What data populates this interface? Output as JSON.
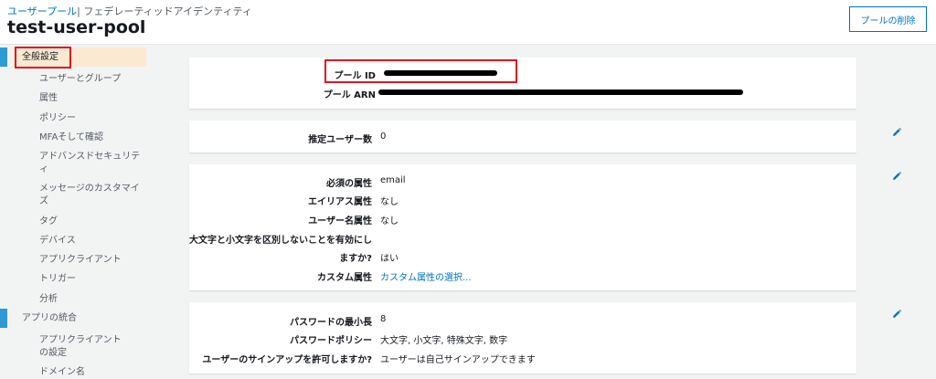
{
  "breadcrumb": {
    "user_pools": "ユーザープール",
    "separator": "|",
    "federated": "フェデレーティッドアイデンティティ"
  },
  "page_title": "test-user-pool",
  "delete_button": "プールの削除",
  "sidebar": {
    "general": "全般設定",
    "items": [
      "ユーザーとグループ",
      "属性",
      "ポリシー",
      "MFAそして確認",
      "アドバンスドセキュリティ",
      "メッセージのカスタマイズ",
      "タグ",
      "デバイス",
      "アプリクライアント",
      "トリガー",
      "分析"
    ],
    "app_integration": "アプリの統合",
    "app_items": [
      "アプリクライアントの設定",
      "ドメイン名"
    ]
  },
  "pool_info": {
    "pool_id_label": "プール ID",
    "pool_arn_label": "プール ARN"
  },
  "estimated_users": {
    "label": "推定ユーザー数",
    "value": "0"
  },
  "attributes": {
    "required_label": "必須の属性",
    "required_value": "email",
    "alias_label": "エイリアス属性",
    "alias_value": "なし",
    "username_label": "ユーザー名属性",
    "username_value": "なし",
    "case_label_1": "大文字と小文字を区別しないことを有効にし",
    "case_label_2": "ますか?",
    "case_value": "はい",
    "custom_label": "カスタム属性",
    "custom_link": "カスタム属性の選択..."
  },
  "password": {
    "min_length_label": "パスワードの最小長",
    "min_length_value": "8",
    "policy_label": "パスワードポリシー",
    "policy_value": "大文字, 小文字, 特殊文字, 数字",
    "signup_label": "ユーザーのサインアップを許可しますか?",
    "signup_value": "ユーザーは自己サインアップできます"
  },
  "colors": {
    "accent": "#0073bb",
    "highlight": "#e0141e",
    "active_bg": "#fbe9d2",
    "bar": "#2e9ad6"
  },
  "icons": {
    "edit": "pencil-icon"
  }
}
